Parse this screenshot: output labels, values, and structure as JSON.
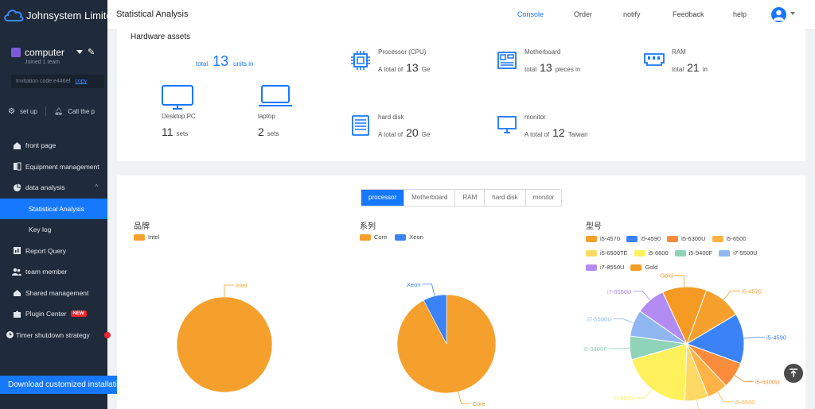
{
  "sidebar": {
    "brand": "Johnsystem Limited",
    "account": {
      "name": "computer",
      "sub": "Joined 1 team",
      "invite_label": "Invitation code:e446ef",
      "copy_label": "copy"
    },
    "setup_label": "set up",
    "call_label": "Call the p",
    "items": [
      {
        "label": "front page"
      },
      {
        "label": "Equipment management"
      },
      {
        "label": "data analysis"
      },
      {
        "label": "Statistical Analysis"
      },
      {
        "label": "Key log"
      },
      {
        "label": "Report Query"
      },
      {
        "label": "team member"
      },
      {
        "label": "Shared management"
      },
      {
        "label": "Plugin Center"
      },
      {
        "label": "Timer shutdown strategy"
      }
    ],
    "new_badge": "NEW",
    "download_label": "Download customized installation"
  },
  "header": {
    "title": "Statistical Analysis",
    "nav": [
      "Console",
      "Order",
      "notify",
      "Feedback",
      "help"
    ]
  },
  "hardware": {
    "title": "Hardware assets",
    "total": {
      "prefix": "total",
      "value": "13",
      "suffix": "units in"
    },
    "desktop": {
      "label": "Desktop PC",
      "value": "11",
      "unit": "sets"
    },
    "laptop": {
      "label": "laptop",
      "value": "2",
      "unit": "sets"
    },
    "cpu": {
      "label": "Processor (CPU)",
      "prefix": "A total of",
      "value": "13",
      "unit": "Ge"
    },
    "motherboard": {
      "label": "Motherboard",
      "prefix": "total",
      "value": "13",
      "unit": "pieces in"
    },
    "ram": {
      "label": "RAM",
      "prefix": "total",
      "value": "21",
      "unit": "in"
    },
    "disk": {
      "label": "hard disk",
      "prefix": "A total of",
      "value": "20",
      "unit": "Ge"
    },
    "monitor": {
      "label": "monitor",
      "prefix": "A total of",
      "value": "12",
      "unit": "Taiwan"
    }
  },
  "tabs": [
    "processor",
    "Motherboard",
    "RAM",
    "hard disk",
    "monitor"
  ],
  "chart_data": [
    {
      "type": "pie",
      "title": "品牌",
      "categories": [
        "Intel"
      ],
      "values": [
        13
      ],
      "colors": [
        "#f5a02c"
      ],
      "legend": "top-left"
    },
    {
      "type": "pie",
      "title": "系列",
      "categories": [
        "Core",
        "Xeon"
      ],
      "values": [
        12,
        1
      ],
      "colors": [
        "#f5a02c",
        "#3b82f6"
      ],
      "legend": "top-left"
    },
    {
      "type": "pie",
      "title": "型号",
      "categories": [
        "i5-4570",
        "i5-4590",
        "i5-6300U",
        "i5-6500",
        "i5-6500TE",
        "i5-6600",
        "i5-9400F",
        "i7-5500U",
        "i7-8550U",
        "Gold"
      ],
      "values": [
        1.3,
        1.7,
        0.9,
        0.7,
        0.8,
        2.4,
        0.8,
        0.9,
        1.0,
        1.5
      ],
      "colors": [
        "#f5a02c",
        "#3b82f6",
        "#fa8c3c",
        "#ffb347",
        "#ffd966",
        "#fff15c",
        "#8fd3b8",
        "#8fb6f0",
        "#b28cf2",
        "#f59a23"
      ],
      "legend": "top-left"
    }
  ],
  "colors": {
    "accent": "#1677ff",
    "sidebar": "#1f2a3a"
  }
}
